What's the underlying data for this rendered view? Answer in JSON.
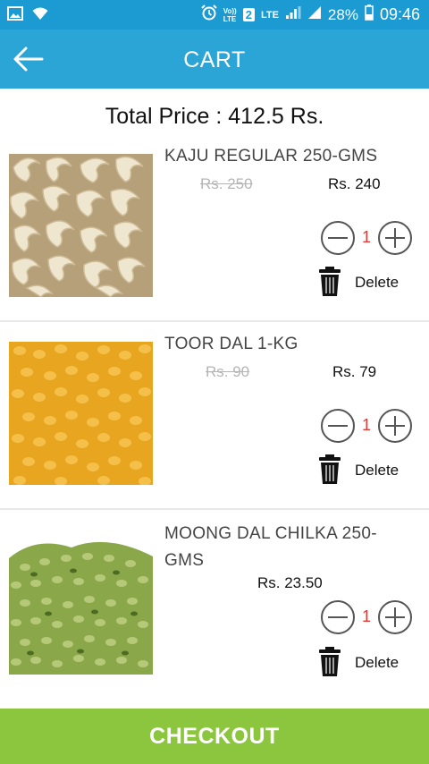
{
  "status_bar": {
    "network_label_top": "Vo))",
    "network_label_bottom": "LTE",
    "sim_slot": "2",
    "lte_label": "LTE",
    "battery_percent": "28%",
    "time": "09:46"
  },
  "app_bar": {
    "title": "CART",
    "back_icon": "arrow-left-icon"
  },
  "summary": {
    "total_price": "Total Price : 412.5 Rs."
  },
  "items": [
    {
      "name": "KAJU REGULAR 250-GMS",
      "mrp": "Rs. 250",
      "price": "Rs. 240",
      "quantity": "1",
      "delete_label": "Delete",
      "image": "cashew-nuts"
    },
    {
      "name": "TOOR DAL 1-KG",
      "mrp": "Rs. 90",
      "price": "Rs. 79",
      "quantity": "1",
      "delete_label": "Delete",
      "image": "toor-dal"
    },
    {
      "name": "MOONG DAL CHILKA 250-GMS",
      "mrp": "",
      "price": "Rs. 23.50",
      "quantity": "1",
      "delete_label": "Delete",
      "image": "moong-dal"
    }
  ],
  "checkout": {
    "label": "CHECKOUT"
  },
  "colors": {
    "app_bar": "#2ba4d6",
    "status_bar": "#1c9bd3",
    "checkout": "#8cc63f",
    "quantity": "#e53935"
  }
}
